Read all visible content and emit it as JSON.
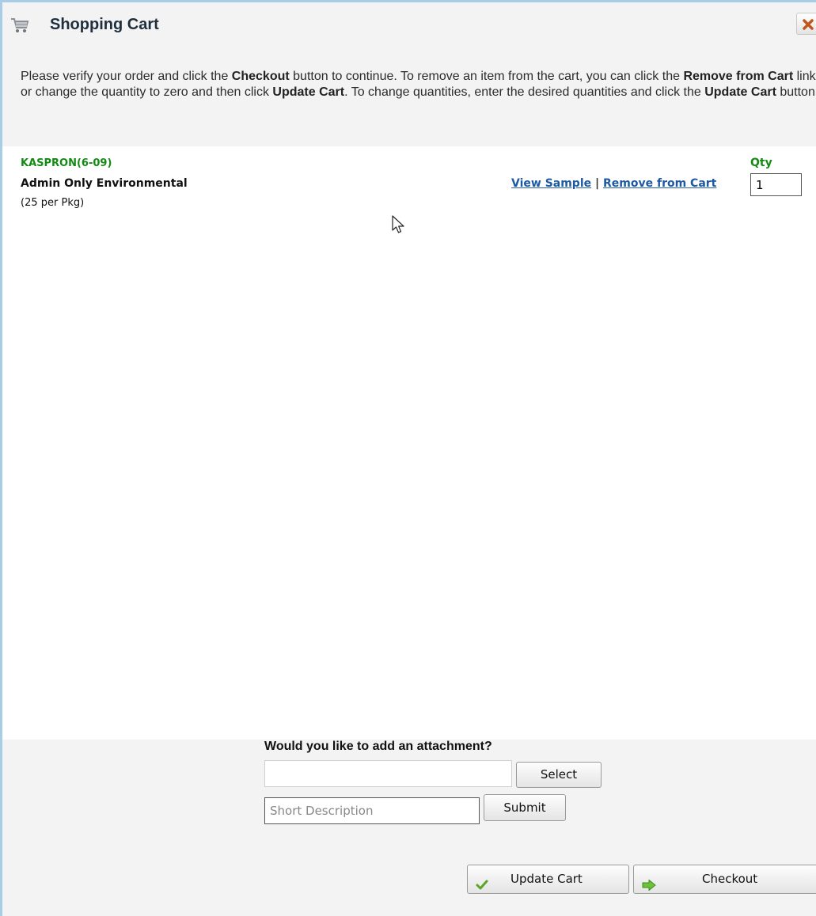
{
  "header": {
    "title": "Shopping Cart",
    "cart_icon": "shopping-cart-icon",
    "close_icon": "close-icon"
  },
  "instructions": {
    "part1": "Please verify your order and click the ",
    "checkout": "Checkout",
    "part2": " button to continue. To remove an item from the cart, you can click the ",
    "remove": "Remove from Cart",
    "part3": " link or change the quantity to zero and then click ",
    "update1": "Update Cart",
    "part4": ". To change quantities, enter the desired quantities and click the ",
    "update2": "Update Cart",
    "part5": " button."
  },
  "cart_item": {
    "code": "KASPRON(6-09)",
    "name": "Admin Only Environmental",
    "package": "(25 per Pkg)",
    "view_sample": "View Sample",
    "separator": " | ",
    "remove": "Remove from Cart",
    "qty_label": "Qty",
    "qty_value": "1"
  },
  "attachment": {
    "title": "Would you like to add an attachment?",
    "select_label": "Select",
    "description_placeholder": "Short Description",
    "submit_label": "Submit"
  },
  "footer": {
    "update_label": "Update Cart",
    "update_icon": "checkmark-icon",
    "checkout_label": "Checkout",
    "checkout_icon": "arrow-right-icon"
  },
  "colors": {
    "accent_green": "#138a13",
    "link_blue": "#1d5aa3",
    "border_blue": "#a9cde6"
  }
}
